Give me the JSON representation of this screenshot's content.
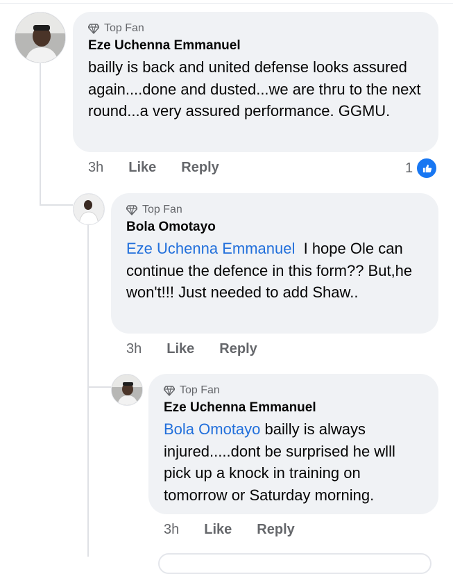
{
  "comments": [
    {
      "badge": "Top Fan",
      "author": "Eze Uchenna Emmanuel",
      "mention": "",
      "text": "bailly is back and united defense looks assured again....done and dusted...we are thru to the next round...a very assured performance. GGMU.",
      "time": "3h",
      "like_label": "Like",
      "reply_label": "Reply",
      "reaction_count": "1",
      "reaction_icon": "thumbs-up-icon"
    },
    {
      "badge": "Top Fan",
      "author": "Bola Omotayo",
      "mention": "Eze Uchenna Emmanuel",
      "text": "I hope Ole can continue the defence in this form?? But,he won't!!! Just needed to add Shaw..",
      "time": "3h",
      "like_label": "Like",
      "reply_label": "Reply"
    },
    {
      "badge": "Top Fan",
      "author": "Eze Uchenna Emmanuel",
      "mention": "Bola Omotayo",
      "text": "bailly is always injured.....dont be surprised he wlll pick up a knock in training on tomorrow or Saturday morning.",
      "time": "3h",
      "like_label": "Like",
      "reply_label": "Reply"
    }
  ],
  "colors": {
    "bubble": "#f0f2f5",
    "mention": "#216fdb",
    "meta": "#65676b",
    "like_blue": "#1877f2"
  }
}
